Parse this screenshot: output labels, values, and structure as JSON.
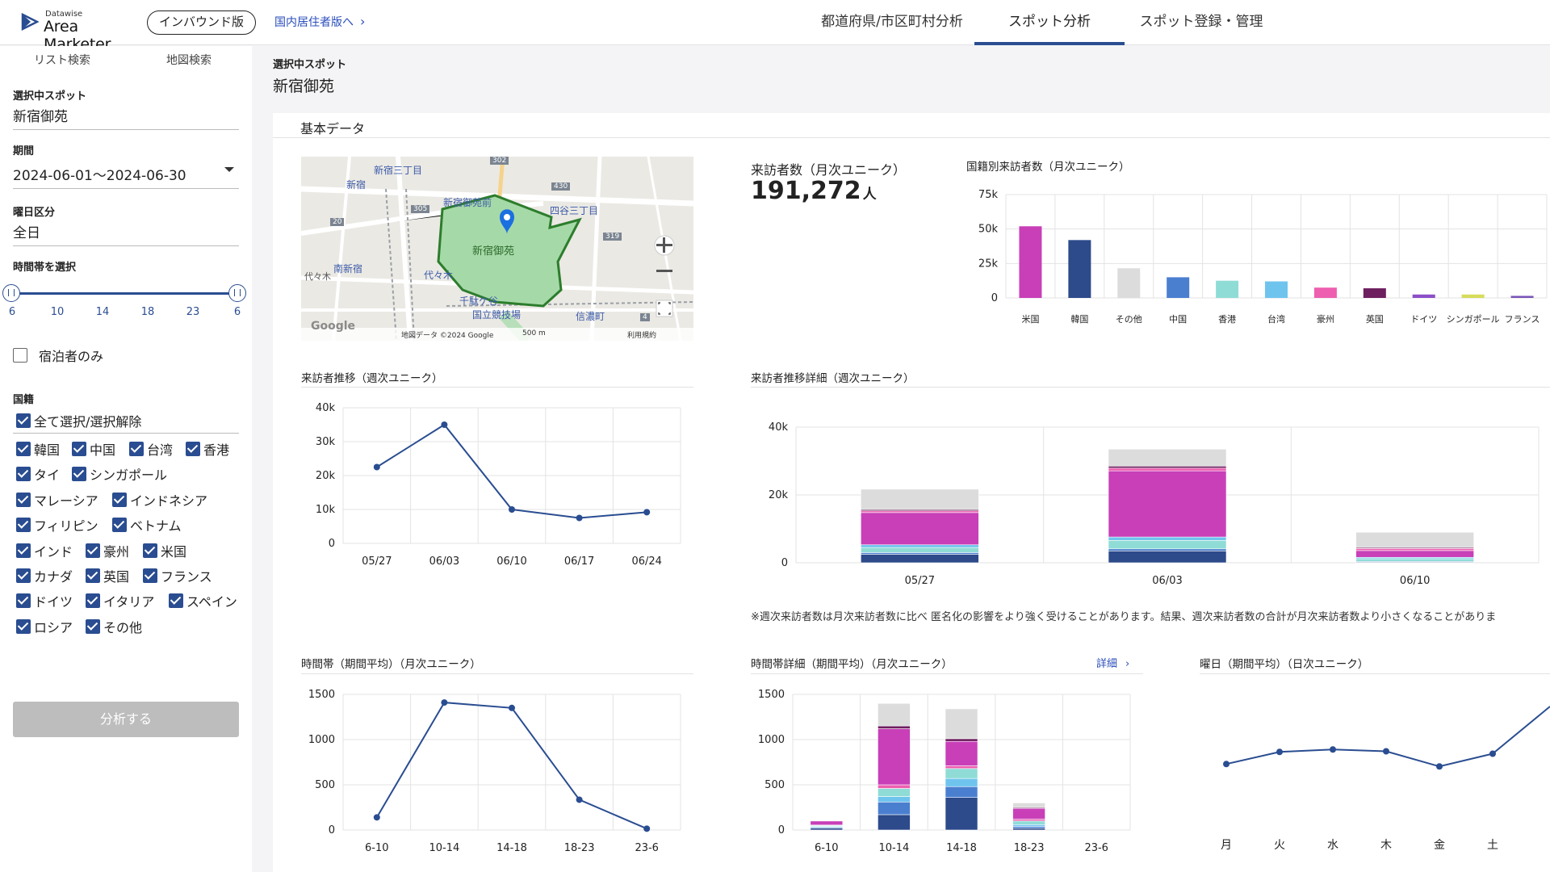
{
  "header": {
    "brand_small": "Datawise",
    "brand": "Area Marketer",
    "edition": "インバウンド版",
    "domestic_link": "国内居住者版へ",
    "tabs": [
      "都道府県/市区町村分析",
      "スポット分析",
      "スポット登録・管理"
    ],
    "active_tab": "スポット分析"
  },
  "sidebar": {
    "tabs": [
      "リスト検索",
      "地図検索"
    ],
    "spot_label": "選択中スポット",
    "spot_value": "新宿御苑",
    "period_label": "期間",
    "period_value": "2024-06-01〜2024-06-30",
    "weekday_label": "曜日区分",
    "weekday_value": "全日",
    "time_label": "時間帯を選択",
    "time_ticks": [
      "6",
      "10",
      "14",
      "18",
      "23",
      "6"
    ],
    "stay_only": "宿泊者のみ",
    "nationality_label": "国籍",
    "select_all": "全て選択/選択解除",
    "countries": [
      "韓国",
      "中国",
      "台湾",
      "香港",
      "タイ",
      "シンガポール",
      "マレーシア",
      "インドネシア",
      "フィリピン",
      "ベトナム",
      "インド",
      "豪州",
      "米国",
      "カナダ",
      "英国",
      "フランス",
      "ドイツ",
      "イタリア",
      "スペイン",
      "ロシア",
      "その他"
    ],
    "analyze_button": "分析する"
  },
  "main": {
    "selected_label": "選択中スポット",
    "selected_value": "新宿御苑",
    "card_title": "基本データ",
    "map": {
      "labels": [
        "新宿三丁目",
        "新宿",
        "新宿御苑前",
        "四谷三丁目",
        "新宿御苑",
        "南新宿",
        "代々木",
        "千駄ケ谷",
        "国立競技場",
        "信濃町",
        "代々木"
      ],
      "route_numbers": [
        "302",
        "430",
        "305",
        "319",
        "20",
        "4"
      ],
      "footer": "地図データ ©2024 Google",
      "scale": "500 m",
      "terms": "利用規約",
      "google": "Google"
    },
    "visitors_label": "来訪者数（月次ユニーク）",
    "visitors_value": "191,272",
    "visitors_unit": "人",
    "country_chart_title": "国籍別来訪者数（月次ユニーク）",
    "weekly_title": "来訪者推移（週次ユニーク）",
    "weekly_detail_title": "来訪者推移詳細（週次ユニーク）",
    "note": "※週次来訪者数は月次来訪者数に比べ 匿名化の影響をより強く受けることがあります。結果、週次来訪者数の合計が月次来訪者数より小さくなることがありま",
    "hourly_title": "時間帯（期間平均）（月次ユニーク）",
    "hourly_detail_title": "時間帯詳細（期間平均）（月次ユニーク）",
    "detail_link": "詳細",
    "weekday_title": "曜日（期間平均）（日次ユニーク）"
  },
  "colors": {
    "accent": "#2a4d91",
    "link": "#2a4dbb",
    "series": {
      "米国": "#c83fb8",
      "韓国": "#2d4a8a",
      "その他": "#dcdcdc",
      "中国": "#4a7fd0",
      "香港": "#8fdcd6",
      "台湾": "#6fc4ee",
      "豪州": "#ee5fb0",
      "英国": "#6e1f5f",
      "ドイツ": "#8b4fc8",
      "シンガポール": "#d6dc5a",
      "フランス": "#7a55b8"
    }
  },
  "chart_data": [
    {
      "id": "country",
      "type": "bar",
      "categories": [
        "米国",
        "韓国",
        "その他",
        "中国",
        "香港",
        "台湾",
        "豪州",
        "英国",
        "ドイツ",
        "シンガポール",
        "フランス"
      ],
      "values": [
        52000,
        42000,
        21500,
        15000,
        12500,
        12000,
        7500,
        7000,
        2500,
        2500,
        1500
      ],
      "yticks": [
        "0",
        "25k",
        "50k",
        "75k"
      ],
      "ylim": [
        0,
        75000
      ]
    },
    {
      "id": "weekly",
      "type": "line",
      "categories": [
        "05/27",
        "06/03",
        "06/10",
        "06/17",
        "06/24"
      ],
      "values": [
        22500,
        35000,
        10000,
        7500,
        9200
      ],
      "yticks": [
        "0",
        "10k",
        "20k",
        "30k",
        "40k"
      ],
      "ylim": [
        0,
        40000
      ]
    },
    {
      "id": "weekly_detail",
      "type": "bar",
      "stacked": true,
      "categories": [
        "05/27",
        "06/03",
        "06/10"
      ],
      "series": [
        {
          "name": "韓国",
          "values": [
            2500,
            3500,
            200
          ]
        },
        {
          "name": "中国",
          "values": [
            500,
            600,
            200
          ]
        },
        {
          "name": "香港",
          "values": [
            1500,
            2500,
            800
          ]
        },
        {
          "name": "台湾",
          "values": [
            800,
            1000,
            400
          ]
        },
        {
          "name": "米国",
          "values": [
            9500,
            19500,
            2000
          ]
        },
        {
          "name": "豪州",
          "values": [
            500,
            800,
            600
          ]
        },
        {
          "name": "英国",
          "values": [
            400,
            600,
            300
          ]
        },
        {
          "name": "その他",
          "values": [
            6000,
            5000,
            4500
          ]
        }
      ],
      "yticks": [
        "0",
        "20k",
        "40k"
      ],
      "ylim": [
        0,
        40000
      ]
    },
    {
      "id": "hourly",
      "type": "line",
      "categories": [
        "6-10",
        "10-14",
        "14-18",
        "18-23",
        "23-6"
      ],
      "values": [
        140,
        1410,
        1350,
        335,
        15
      ],
      "yticks": [
        "0",
        "500",
        "1000",
        "1500"
      ],
      "ylim": [
        0,
        1500
      ]
    },
    {
      "id": "hourly_detail",
      "type": "bar",
      "stacked": true,
      "categories": [
        "6-10",
        "10-14",
        "14-18",
        "18-23",
        "23-6"
      ],
      "series": [
        {
          "name": "韓国",
          "values": [
            20,
            170,
            360,
            20,
            0
          ]
        },
        {
          "name": "中国",
          "values": [
            10,
            140,
            120,
            20,
            0
          ]
        },
        {
          "name": "台湾",
          "values": [
            10,
            60,
            90,
            20,
            0
          ]
        },
        {
          "name": "香港",
          "values": [
            10,
            90,
            110,
            40,
            0
          ]
        },
        {
          "name": "豪州",
          "values": [
            5,
            40,
            30,
            20,
            0
          ]
        },
        {
          "name": "米国",
          "values": [
            45,
            620,
            270,
            120,
            0
          ]
        },
        {
          "name": "英国",
          "values": [
            5,
            30,
            30,
            10,
            0
          ]
        },
        {
          "name": "その他",
          "values": [
            5,
            250,
            330,
            50,
            0
          ]
        }
      ],
      "yticks": [
        "0",
        "500",
        "1000",
        "1500"
      ],
      "ylim": [
        0,
        1500
      ]
    },
    {
      "id": "weekday",
      "type": "line",
      "categories": [
        "月",
        "火",
        "水",
        "木",
        "金",
        "土"
      ],
      "values": [
        1050,
        1250,
        1290,
        1260,
        1010,
        1220
      ],
      "ylim": [
        0,
        2200
      ]
    }
  ]
}
